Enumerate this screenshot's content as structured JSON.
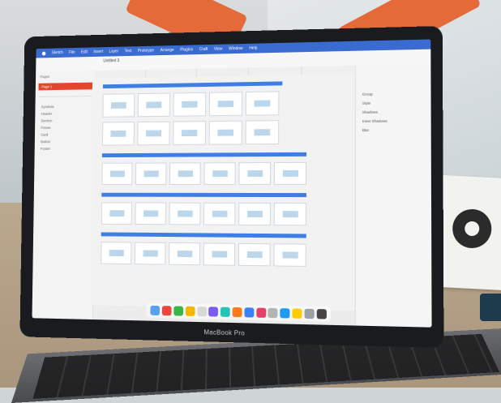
{
  "laptop": {
    "brand_label": "MacBook Pro"
  },
  "screen": {
    "app_name": "Sketch",
    "menu_items": [
      "File",
      "Edit",
      "Insert",
      "Layer",
      "Text",
      "Prototype",
      "Arrange",
      "Plugins",
      "Craft",
      "View",
      "Window",
      "Help"
    ],
    "document_title": "Untitled 3",
    "sidebar": {
      "pages_header": "Pages",
      "active_page": "Page 1",
      "layers": [
        "Symbols",
        "Header",
        "Section",
        "Frame",
        "Card",
        "Button",
        "Footer"
      ]
    },
    "inspector": {
      "rows": [
        "Group",
        "Style",
        "Shadows",
        "Inner Shadows",
        "Blur"
      ]
    },
    "dock_colors": [
      "#5aa0f0",
      "#e9483b",
      "#3ab54a",
      "#f5b800",
      "#d8d8d8",
      "#7a5cf0",
      "#27c4b5",
      "#ff7a1a",
      "#3b82f6",
      "#e63e6d",
      "#b4b4b4",
      "#1f9bf0",
      "#ffcc00",
      "#9aa0a6",
      "#444444"
    ]
  }
}
